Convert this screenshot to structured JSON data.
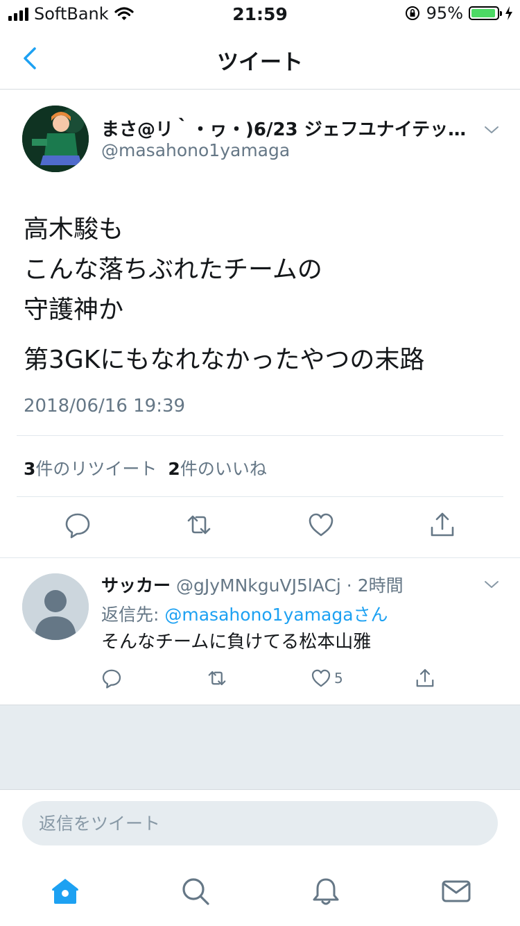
{
  "status_bar": {
    "carrier": "SoftBank",
    "time": "21:59",
    "battery": "95%",
    "battery_fraction": 0.95,
    "battery_color": "#4cd964"
  },
  "nav": {
    "title": "ツイート",
    "back_icon": "chevron-left-icon"
  },
  "tweet": {
    "author_name": "まさ@リ｀・ヮ・)6/23 ジェフユナイテッ…",
    "author_handle": "@masahono1yamaga",
    "text_lines_1": "高木駿も\nこんな落ちぶれたチームの\n守護神か",
    "text_lines_2": "第3GKにもなれなかったやつの末路",
    "timestamp": "2018/06/16 19:39",
    "retweet_count": "3",
    "retweet_label": "件のリツイート",
    "like_count": "2",
    "like_label": "件のいいね"
  },
  "reply": {
    "name": "サッカー",
    "meta": "@gJyMNkguVJ5lACj · 2時間",
    "reply_to_prefix": "返信先: ",
    "reply_to_handle": "@masahono1yamagaさん",
    "text": "そんなチームに負けてる松本山雅",
    "like_count": "5"
  },
  "composer": {
    "placeholder": "返信をツイート"
  },
  "colors": {
    "accent": "#1da1f2",
    "secondary_text": "#657786",
    "background_gray": "#e6ecf0"
  },
  "icons": [
    "chevron-left-icon",
    "chevron-down-icon",
    "reply-icon",
    "retweet-icon",
    "heart-icon",
    "share-icon",
    "home-icon",
    "search-icon",
    "bell-icon",
    "mail-icon",
    "wifi-icon",
    "signal-icon",
    "battery-icon",
    "lock-rotation-icon",
    "charging-icon"
  ]
}
